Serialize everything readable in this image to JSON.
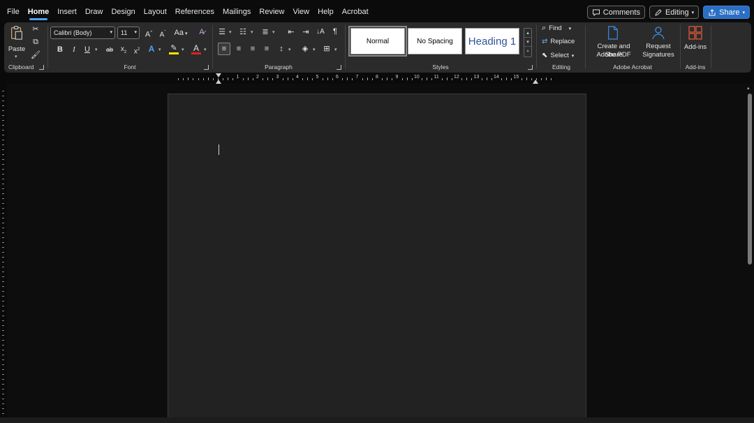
{
  "menu": {
    "tabs": [
      "File",
      "Home",
      "Insert",
      "Draw",
      "Design",
      "Layout",
      "References",
      "Mailings",
      "Review",
      "View",
      "Help",
      "Acrobat"
    ],
    "active": "Home"
  },
  "top_right": {
    "comments": "Comments",
    "editing": "Editing",
    "share": "Share"
  },
  "ribbon": {
    "clipboard": {
      "label": "Clipboard",
      "paste": "Paste"
    },
    "font": {
      "label": "Font",
      "font_name": "Calibri (Body)",
      "font_size": "11",
      "change_case": "Aa"
    },
    "paragraph": {
      "label": "Paragraph"
    },
    "styles": {
      "label": "Styles",
      "items": [
        "Normal",
        "No Spacing",
        "Heading 1"
      ]
    },
    "editing": {
      "label": "Editing",
      "find": "Find",
      "replace": "Replace",
      "select": "Select"
    },
    "acrobat": {
      "label": "Adobe Acrobat",
      "create_line1": "Create and Share",
      "create_line2": "Adobe PDF",
      "request_line1": "Request",
      "request_line2": "Signatures"
    },
    "addins": {
      "label": "Add-ins",
      "button": "Add-ins"
    }
  },
  "ruler": {
    "numbers": [
      "1",
      "2",
      "3",
      "4",
      "5",
      "6",
      "7",
      "8",
      "9",
      "10",
      "11",
      "12",
      "13",
      "14",
      "15"
    ]
  },
  "colors": {
    "accent": "#4aa3f5",
    "share": "#2b6fc4",
    "highlight": "#f5e400",
    "font_color": "#e02020",
    "heading_style": "#2f5496"
  }
}
